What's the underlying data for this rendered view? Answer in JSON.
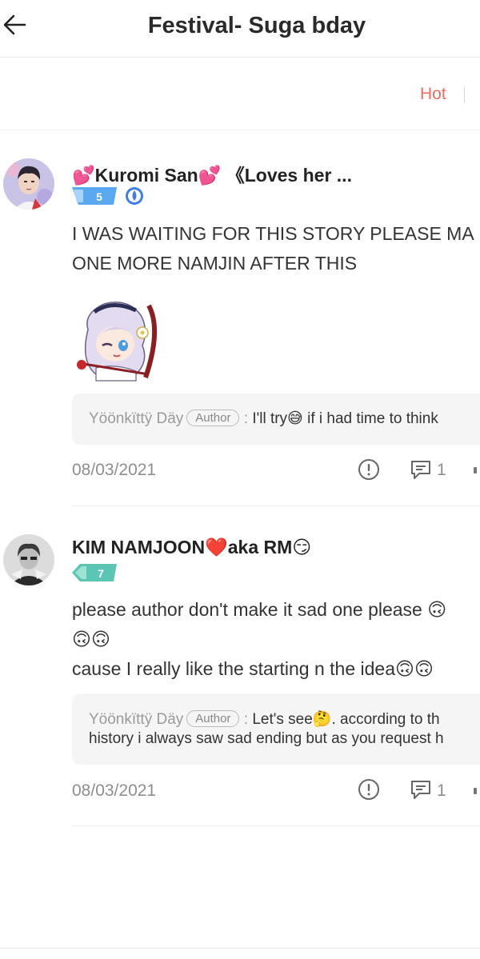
{
  "header": {
    "title": "Festival- Suga bday",
    "back_icon": "arrow-left-icon"
  },
  "sort": {
    "active": "Hot",
    "active_color": "#ee6b60"
  },
  "comments": [
    {
      "user": "💕Kuromi San💕 《Loves her ...",
      "level": "5",
      "level_color": "#5aa8f0",
      "extra_badge_icon": "water-drop-badge-icon",
      "text_lines": [
        "I WAS WAITING FOR THIS STORY PLEASE MA",
        "ONE MORE NAMJIN AFTER THIS"
      ],
      "sticker": "anime-girl-sticker",
      "reply": {
        "name": "Yöönkïttÿ Däy",
        "tag": "Author",
        "sep": ":",
        "text_lines": [
          "I'll try😅 if i had time to think"
        ]
      },
      "date": "08/03/2021",
      "reply_count": "1"
    },
    {
      "user": "KIM NAMJOON❤️aka RM😏",
      "level": "7",
      "level_color": "#5cc6b4",
      "text_lines": [
        "please author don't make it sad one please 🙃",
        "🙃🙃",
        "cause I really like the starting n the idea🙃🙃"
      ],
      "reply": {
        "name": "Yöönkïttÿ Däy",
        "tag": "Author",
        "sep": ":",
        "text_lines": [
          "Let's see🤔. according to th",
          "history i always saw sad ending but as you request h"
        ]
      },
      "date": "08/03/2021",
      "reply_count": "1"
    }
  ]
}
